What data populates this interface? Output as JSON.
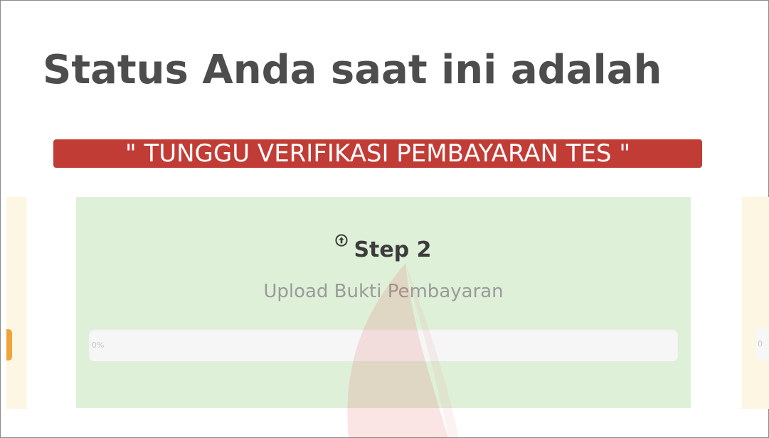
{
  "page": {
    "title": "Status Anda saat ini adalah",
    "status_badge": "\" TUNGGU VERIFIKASI PEMBAYARAN TES \""
  },
  "step": {
    "heading": "Step 2",
    "icon": "upload-circle-icon",
    "subtitle": "Upload Bukti Pembayaran",
    "progress_label": "0%",
    "progress_value": 0
  },
  "side_panels": {
    "right_label": "0"
  },
  "colors": {
    "title": "#4d4d4d",
    "badge_bg": "#c23c36",
    "card_bg": "#dff0d8",
    "side_panel_bg": "#fcf6e2",
    "side_handle": "#f0a33a",
    "watermark": "#e05a5a"
  }
}
